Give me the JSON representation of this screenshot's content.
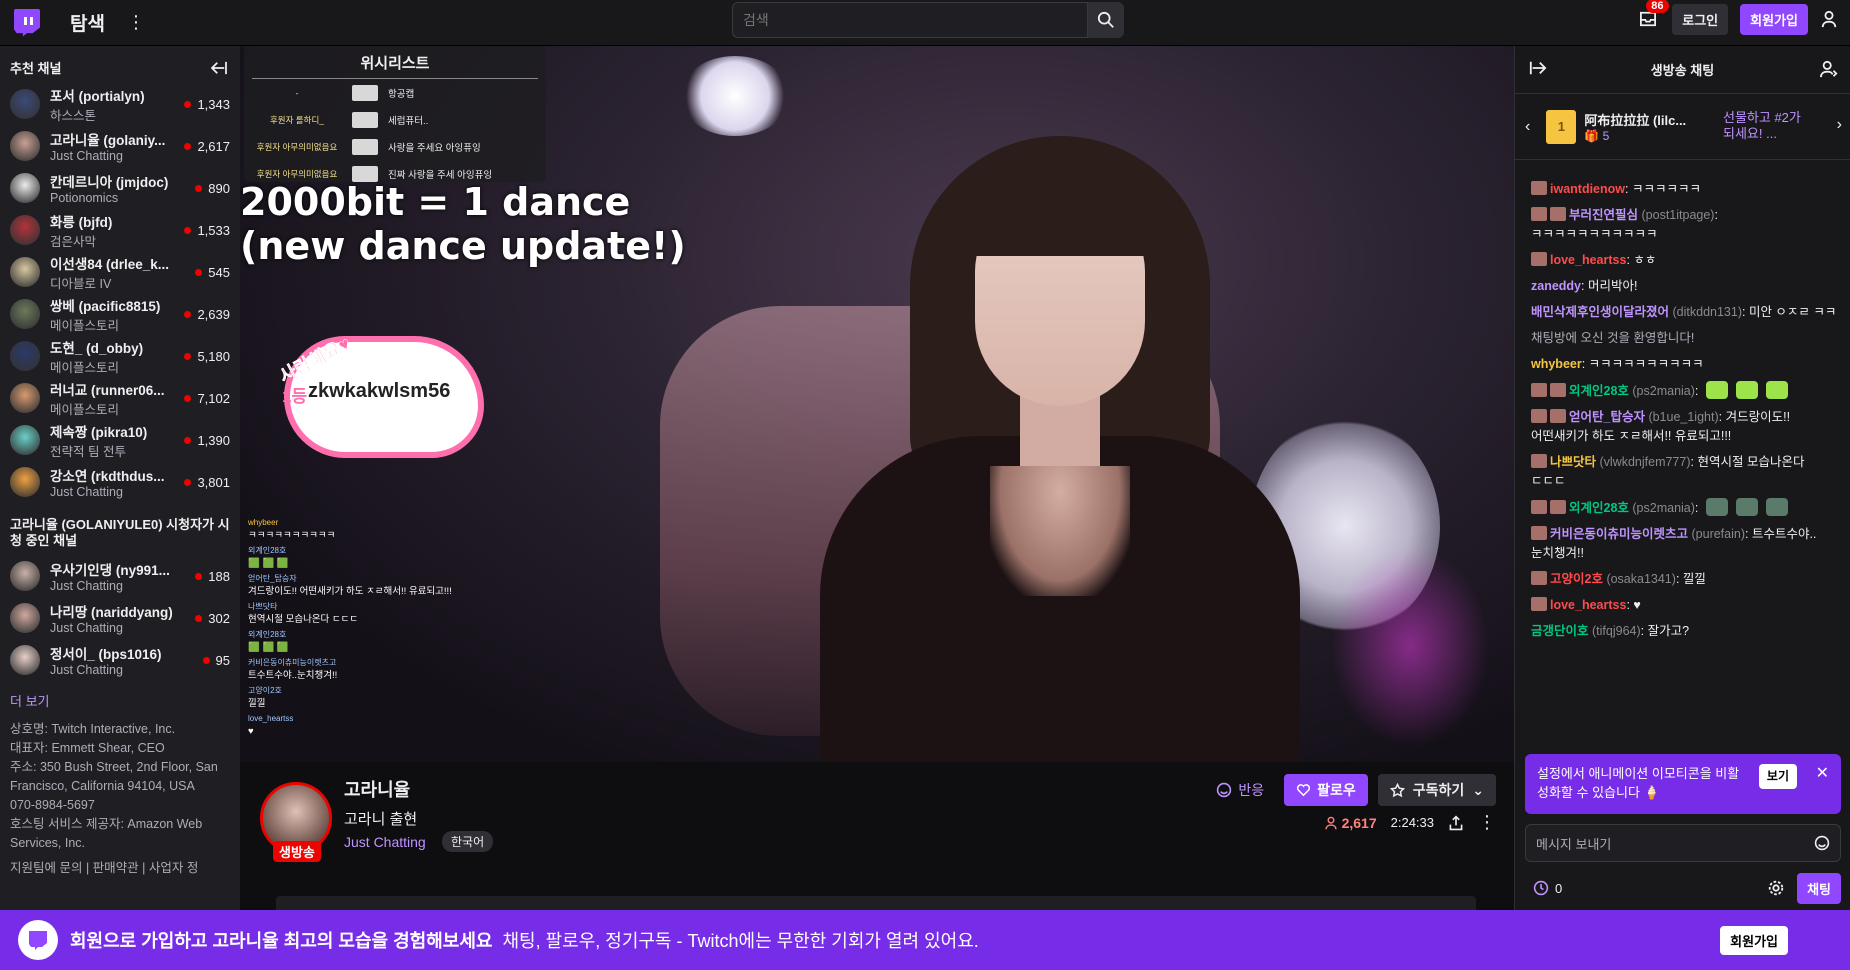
{
  "topbar": {
    "browse_label": "탐색",
    "search_placeholder": "검색",
    "inbox_count": "86",
    "login_label": "로그인",
    "signup_label": "회원가입"
  },
  "sidebar": {
    "recommended_title": "추천 채널",
    "recommended": [
      {
        "name": "포서 (portialyn)",
        "game": "하스스톤",
        "viewers": "1,343",
        "color": "#3a4a7a"
      },
      {
        "name": "고라니율 (golaniy...",
        "game": "Just Chatting",
        "viewers": "2,617",
        "color": "#c8a094"
      },
      {
        "name": "칸데르니아 (jmjdoc)",
        "game": "Potionomics",
        "viewers": "890",
        "color": "#ececec"
      },
      {
        "name": "화릉 (bjfd)",
        "game": "검은사막",
        "viewers": "1,533",
        "color": "#b2333a"
      },
      {
        "name": "이선생84 (drlee_k...",
        "game": "디아블로 IV",
        "viewers": "545",
        "color": "#d8c8a0"
      },
      {
        "name": "쌍베 (pacific8815)",
        "game": "메이플스토리",
        "viewers": "2,639",
        "color": "#6a7a5a"
      },
      {
        "name": "도현_ (d_obby)",
        "game": "메이플스토리",
        "viewers": "5,180",
        "color": "#2a3a6a"
      },
      {
        "name": "러너교 (runner06...",
        "game": "메이플스토리",
        "viewers": "7,102",
        "color": "#d89a70"
      },
      {
        "name": "제속짱 (pikra10)",
        "game": "전략적 팀 전투",
        "viewers": "1,390",
        "color": "#6ad0c8"
      },
      {
        "name": "강소연 (rkdthdus...",
        "game": "Just Chatting",
        "viewers": "3,801",
        "color": "#f0a040"
      }
    ],
    "viewers_also_title": "고라니율 (GOLANIYULE0) 시청자가 시청 중인 채널",
    "also": [
      {
        "name": "우사기인댕 (ny991...",
        "game": "Just Chatting",
        "viewers": "188",
        "color": "#c8b0a8"
      },
      {
        "name": "나리땅 (nariddyang)",
        "game": "Just Chatting",
        "viewers": "302",
        "color": "#d0a8a0"
      },
      {
        "name": "정서이_ (bps1016)",
        "game": "Just Chatting",
        "viewers": "95",
        "color": "#e8d0c8"
      }
    ],
    "more_label": "더 보기",
    "footer": [
      "상호명: Twitch Interactive, Inc.",
      "대표자: Emmett Shear, CEO",
      "주소: 350 Bush Street, 2nd Floor, San Francisco, California 94104, USA",
      "070-8984-5697",
      "호스팅 서비스 제공자: Amazon Web Services, Inc."
    ],
    "footer_links": "지원팀에 문의 | 판매약관 | 사업자 정"
  },
  "video": {
    "wishlist_title": "위시리스트",
    "wishlist": [
      {
        "left": "-",
        "item": "항공캡"
      },
      {
        "left": "후원자 롤하디_",
        "item": "세럽퓨터.."
      },
      {
        "left": "후원자 아무의미없음요",
        "item": "사랑을 주세요 아잉퓨잉"
      },
      {
        "left": "후원자 아무의미없음요",
        "item": "진짜 사랑을 주세 아잉퓨잉"
      }
    ],
    "overlay_line1": "2000bit = 1 dance",
    "overlay_line2": "(new dance update!)",
    "cloud_label": "사랑해요♥",
    "cloud_rank": "1등",
    "cloud_name": "zkwkakwlsm56",
    "overlay_chat": [
      {
        "user": "whybeer",
        "text": "ㅋㅋㅋㅋㅋㅋㅋㅋㅋㅋ",
        "gold": true
      },
      {
        "user": "외계인28호",
        "text": "🟩 🟩 🟩",
        "gold": false
      },
      {
        "user": "얻어탄_탑승자",
        "text": "겨드랑이도!! 어떤새키가 하도 ㅈㄹ해서!! 유료되고!!!",
        "gold": false
      },
      {
        "user": "나쁘닷타",
        "text": "현역시절 모습나온다 ㄷㄷㄷ",
        "gold": false
      },
      {
        "user": "외계인28호",
        "text": "🟩 🟩 🟩",
        "gold": false
      },
      {
        "user": "커비은동이츄미능이렛츠고",
        "text": "트수트수야..눈치챙겨!!",
        "gold": false
      },
      {
        "user": "고양이2호",
        "text": "낄낄",
        "gold": false
      },
      {
        "user": "love_heartss",
        "text": "♥",
        "gold": false
      }
    ]
  },
  "channel": {
    "name": "고라니율",
    "title": "고라니 출현",
    "category": "Just Chatting",
    "language": "한국어",
    "live_label": "생방송",
    "react_label": "반응",
    "follow_label": "팔로우",
    "subscribe_label": "구독하기",
    "viewers": "2,617",
    "uptime": "2:24:33"
  },
  "chat": {
    "title": "생방송 채팅",
    "gift_user": "阿布拉拉拉 (lilc...",
    "gift_count": "5",
    "gift_promo": "선물하고 #2가 되세요! ...",
    "messages": [
      {
        "user": "iwantdienow",
        "secondary": "",
        "text": "ㅋㅋㅋㅋㅋㅋ",
        "color": "#ff4b4b",
        "badges": 1
      },
      {
        "user": "부러진연필심",
        "secondary": "(post1itpage)",
        "text": "ㅋㅋㅋㅋㅋㅋㅋㅋㅋㅋㅋ",
        "color": "#bf94ff",
        "badges": 2
      },
      {
        "user": "love_heartss",
        "secondary": "",
        "text": "ㅎㅎ",
        "color": "#ff4b4b",
        "badges": 1
      },
      {
        "user": "zaneddy",
        "secondary": "",
        "text": "머리박아!",
        "color": "#bf94ff",
        "badges": 0
      },
      {
        "user": "배민삭제후인생이달라졌어",
        "secondary": "(ditkddn131)",
        "text": "미안 ㅇㅈㄹ ㅋㅋ",
        "color": "#bf94ff",
        "badges": 0
      },
      {
        "user": "",
        "secondary": "",
        "text": "채팅방에 오신 것을 환영합니다!",
        "color": "#adadb8",
        "badges": 0
      },
      {
        "user": "whybeer",
        "secondary": "",
        "text": "ㅋㅋㅋㅋㅋㅋㅋㅋㅋㅋ",
        "color": "#f5c542",
        "badges": 0
      },
      {
        "user": "외계인28호",
        "secondary": "(ps2mania)",
        "text": "",
        "color": "#00c781",
        "badges": 2,
        "emotes": 3
      },
      {
        "user": "얻어탄_탑승자",
        "secondary": "(b1ue_1ight)",
        "text": "겨드랑이도!! 어떤새키가 하도 ㅈㄹ해서!! 유료되고!!!",
        "color": "#bf94ff",
        "badges": 2
      },
      {
        "user": "나쁘닷타",
        "secondary": "(vlwkdnjfem777)",
        "text": "현역시절 모습나온다 ㄷㄷㄷ",
        "color": "#f5c542",
        "badges": 1
      },
      {
        "user": "외계인28호",
        "secondary": "(ps2mania)",
        "text": "",
        "color": "#00c781",
        "badges": 2,
        "emotes": 3,
        "dark": true
      },
      {
        "user": "커비은동이츄미능이렛츠고",
        "secondary": "(purefain)",
        "text": "트수트수야..눈치챙겨!!",
        "color": "#bf94ff",
        "badges": 1
      },
      {
        "user": "고양이2호",
        "secondary": "(osaka1341)",
        "text": "낄낄",
        "color": "#ff4b4b",
        "badges": 1
      },
      {
        "user": "love_heartss",
        "secondary": "",
        "text": "♥",
        "color": "#ff4b4b",
        "badges": 1
      },
      {
        "user": "금갱단이호",
        "secondary": "(tifqj964)",
        "text": "잘가고?",
        "color": "#00c781",
        "badges": 0
      }
    ],
    "notice_text": "설정에서 애니메이션 이모티콘을 비활성화할 수 있습니다 🍦",
    "notice_view": "보기",
    "input_placeholder": "메시지 보내기",
    "points": "0",
    "send_label": "채팅"
  },
  "banner": {
    "strong": "회원으로 가입하고 고라니율 최고의 모습을 경험해보세요",
    "sub": "채팅, 팔로우, 정기구독 - Twitch에는 무한한 기회가 열려 있어요.",
    "button": "회원가입"
  }
}
